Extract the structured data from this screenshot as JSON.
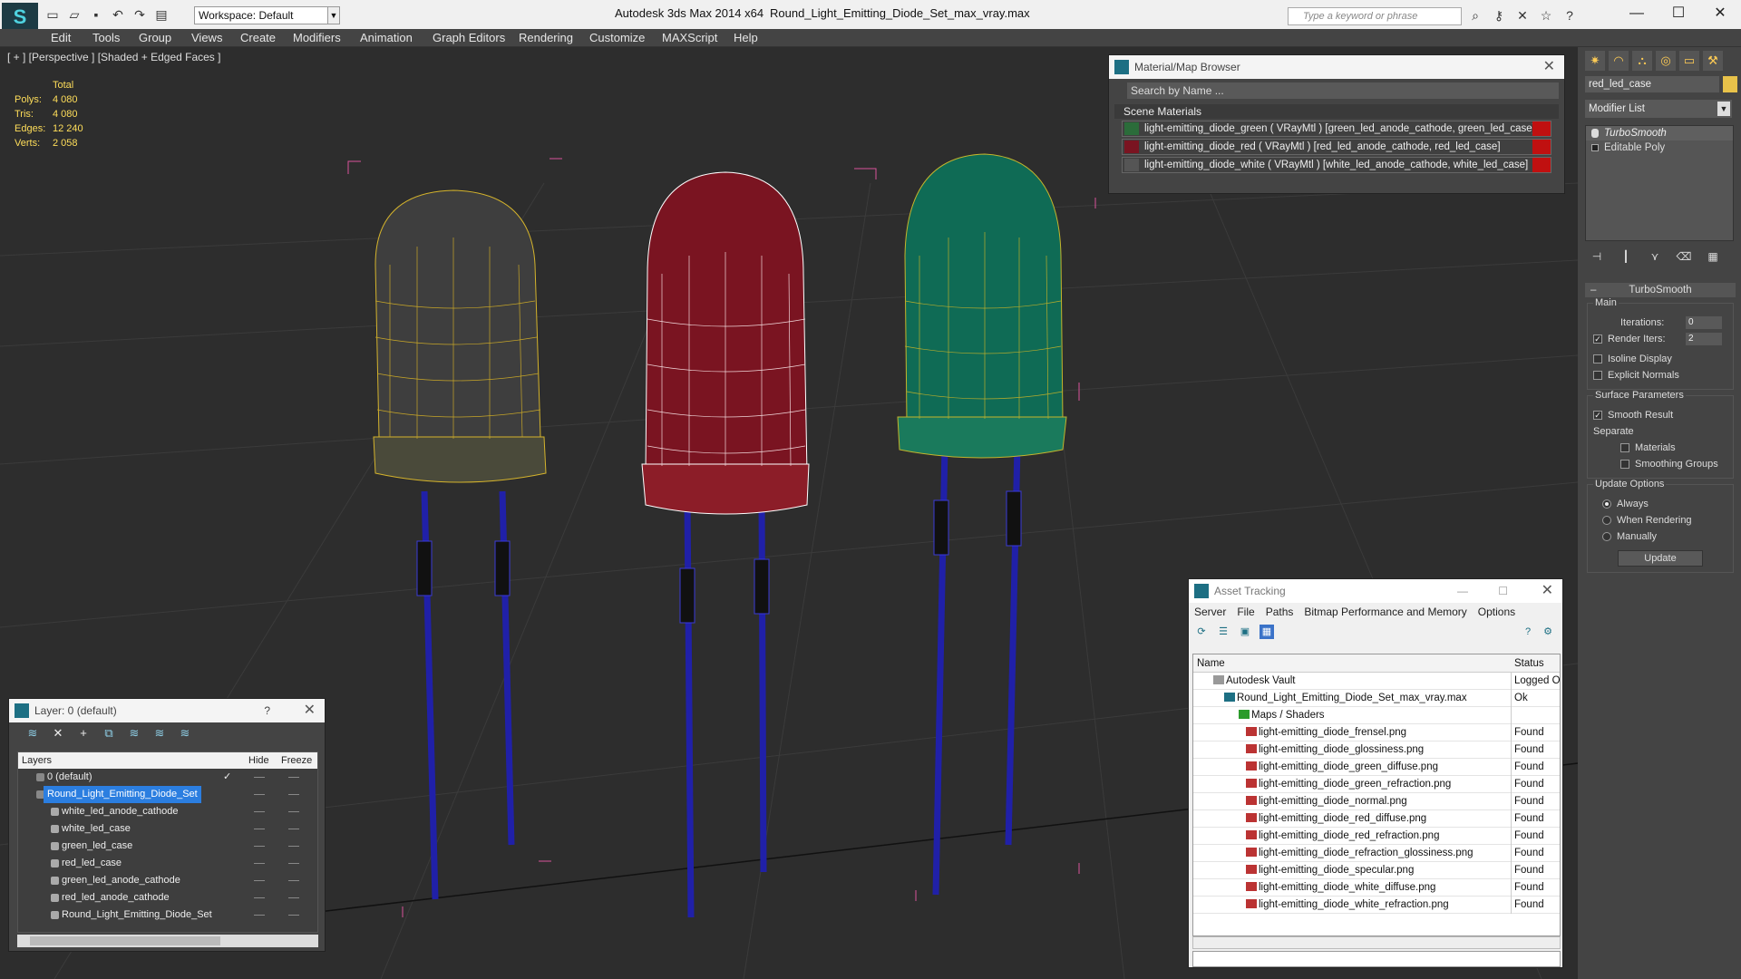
{
  "titlebar": {
    "workspace_label": "Workspace: Default",
    "app_title": "Autodesk 3ds Max  2014 x64",
    "doc_title": "Round_Light_Emitting_Diode_Set_max_vray.max",
    "search_placeholder": "Type a keyword or phrase"
  },
  "menu": [
    "Edit",
    "Tools",
    "Group",
    "Views",
    "Create",
    "Modifiers",
    "Animation",
    "Graph Editors",
    "Rendering",
    "Customize",
    "MAXScript",
    "Help"
  ],
  "viewport": {
    "label": "[ + ] [Perspective ] [Shaded + Edged Faces ]",
    "stats": {
      "header": "Total",
      "rows": [
        {
          "k": "Polys:",
          "v": "4 080"
        },
        {
          "k": "Tris:",
          "v": "4 080"
        },
        {
          "k": "Edges:",
          "v": "12 240"
        },
        {
          "k": "Verts:",
          "v": "2 058"
        }
      ]
    }
  },
  "material_browser": {
    "title": "Material/Map Browser",
    "search_placeholder": "Search by Name ...",
    "section": "Scene Materials",
    "items": [
      "light-emitting_diode_green  ( VRayMtl ) [green_led_anode_cathode, green_led_case]",
      "light-emitting_diode_red  ( VRayMtl ) [red_led_anode_cathode, red_led_case]",
      "light-emitting_diode_white  ( VRayMtl ) [white_led_anode_cathode, white_led_case]"
    ]
  },
  "command_panel": {
    "object_name": "red_led_case",
    "modifier_list": "Modifier List",
    "stack": [
      "TurboSmooth",
      "Editable Poly"
    ],
    "rollout_title": "TurboSmooth",
    "main_group": "Main",
    "iterations_label": "Iterations:",
    "iterations_value": "0",
    "render_iters_label": "Render Iters:",
    "render_iters_value": "2",
    "isoline": "Isoline Display",
    "explicit_normals": "Explicit Normals",
    "surface_group": "Surface Parameters",
    "smooth_result": "Smooth Result",
    "separate": "Separate",
    "materials": "Materials",
    "smoothing_groups": "Smoothing Groups",
    "update_group": "Update Options",
    "always": "Always",
    "when_rendering": "When Rendering",
    "manually": "Manually",
    "update_button": "Update"
  },
  "layers": {
    "title": "Layer: 0 (default)",
    "help": "?",
    "col_layers": "Layers",
    "col_hide": "Hide",
    "col_freeze": "Freeze",
    "rows": [
      "0 (default)",
      "Round_Light_Emitting_Diode_Set",
      "white_led_anode_cathode",
      "white_led_case",
      "green_led_case",
      "red_led_case",
      "green_led_anode_cathode",
      "red_led_anode_cathode",
      "Round_Light_Emitting_Diode_Set"
    ]
  },
  "asset_tracking": {
    "title": "Asset Tracking",
    "menu": [
      "Server",
      "File",
      "Paths",
      "Bitmap Performance and Memory",
      "Options"
    ],
    "col_name": "Name",
    "col_status": "Status",
    "rows": [
      {
        "name": "Autodesk Vault",
        "status": "Logged O"
      },
      {
        "name": "Round_Light_Emitting_Diode_Set_max_vray.max",
        "status": "Ok"
      },
      {
        "name": "Maps / Shaders",
        "status": ""
      },
      {
        "name": "light-emitting_diode_frensel.png",
        "status": "Found"
      },
      {
        "name": "light-emitting_diode_glossiness.png",
        "status": "Found"
      },
      {
        "name": "light-emitting_diode_green_diffuse.png",
        "status": "Found"
      },
      {
        "name": "light-emitting_diode_green_refraction.png",
        "status": "Found"
      },
      {
        "name": "light-emitting_diode_normal.png",
        "status": "Found"
      },
      {
        "name": "light-emitting_diode_red_diffuse.png",
        "status": "Found"
      },
      {
        "name": "light-emitting_diode_red_refraction.png",
        "status": "Found"
      },
      {
        "name": "light-emitting_diode_refraction_glossiness.png",
        "status": "Found"
      },
      {
        "name": "light-emitting_diode_specular.png",
        "status": "Found"
      },
      {
        "name": "light-emitting_diode_white_diffuse.png",
        "status": "Found"
      },
      {
        "name": "light-emitting_diode_white_refraction.png",
        "status": "Found"
      }
    ]
  }
}
